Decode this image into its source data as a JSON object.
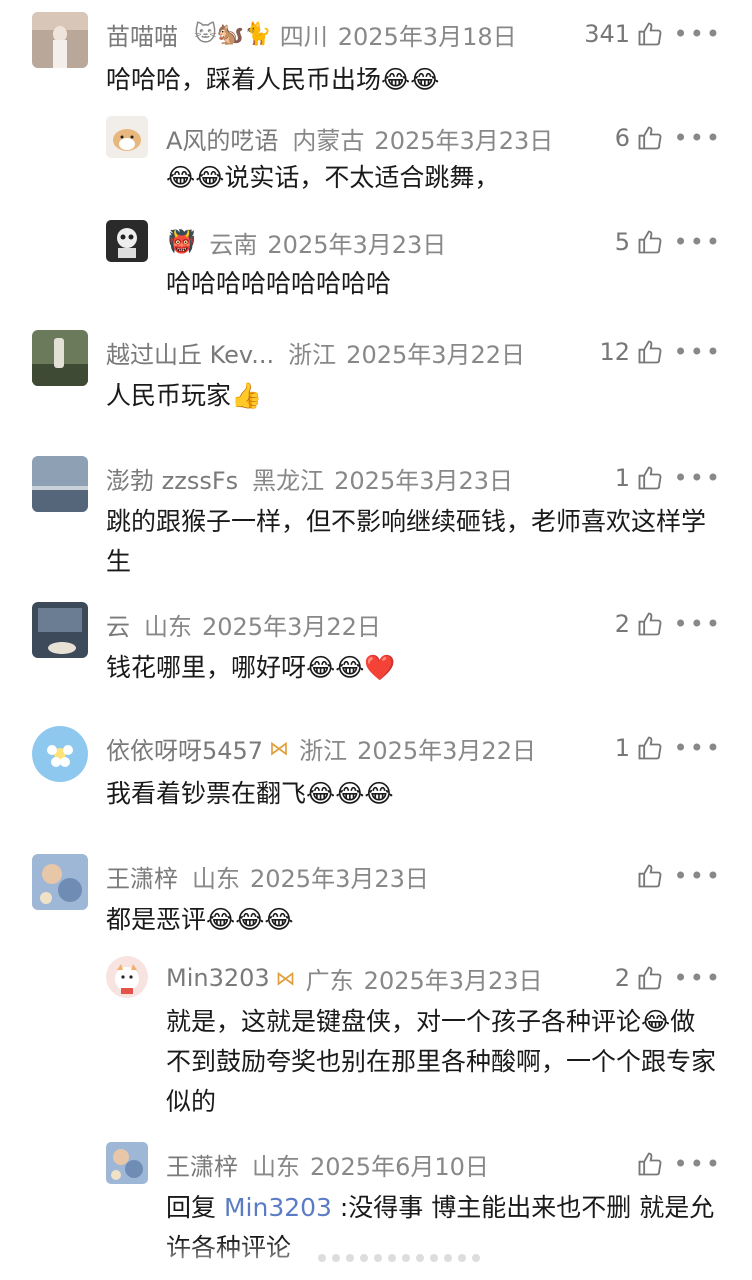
{
  "comments": [
    {
      "user": "苗喵喵",
      "emojis": "🐱🐿️🐈",
      "location": "四川",
      "date": "2025年3月18日",
      "likes": "341",
      "text": "哈哈哈，踩着人民币出场😂😂"
    },
    {
      "user": "A风的呓语",
      "location": "内蒙古",
      "date": "2025年3月23日",
      "likes": "6",
      "text": "😂😂说实话，不太适合跳舞，"
    },
    {
      "user": "",
      "emoji_prefix": "👹",
      "location": "云南",
      "date": "2025年3月23日",
      "likes": "5",
      "text": "哈哈哈哈哈哈哈哈哈"
    },
    {
      "user": "越过山丘 Kev...",
      "location": "浙江",
      "date": "2025年3月22日",
      "likes": "12",
      "text": "人民币玩家👍"
    },
    {
      "user": "澎勃 zzssFs",
      "location": "黑龙江",
      "date": "2025年3月23日",
      "likes": "1",
      "text": "跳的跟猴子一样，但不影响继续砸钱，老师喜欢这样学生"
    },
    {
      "user": "云",
      "location": "山东",
      "date": "2025年3月22日",
      "likes": "2",
      "text": "钱花哪里，哪好呀😂😂❤️"
    },
    {
      "user": "依依呀呀5457",
      "location": "浙江",
      "date": "2025年3月22日",
      "likes": "1",
      "text": "我看着钞票在翻飞😂😂😂"
    },
    {
      "user": "王潇梓",
      "location": "山东",
      "date": "2025年3月23日",
      "likes": "",
      "text": "都是恶评😂😂😂"
    },
    {
      "user": "Min3203",
      "location": "广东",
      "date": "2025年3月23日",
      "likes": "2",
      "text": "就是，这就是键盘侠，对一个孩子各种评论😂做不到鼓励夸奖也别在那里各种酸啊，一个个跟专家似的"
    },
    {
      "user": "王潇梓",
      "location": "山东",
      "date": "2025年6月10日",
      "likes": "",
      "text_prefix": "回复 ",
      "mention": "Min3203",
      "text": " :没得事  博主能出来也不删 就是允许各种评论"
    }
  ]
}
